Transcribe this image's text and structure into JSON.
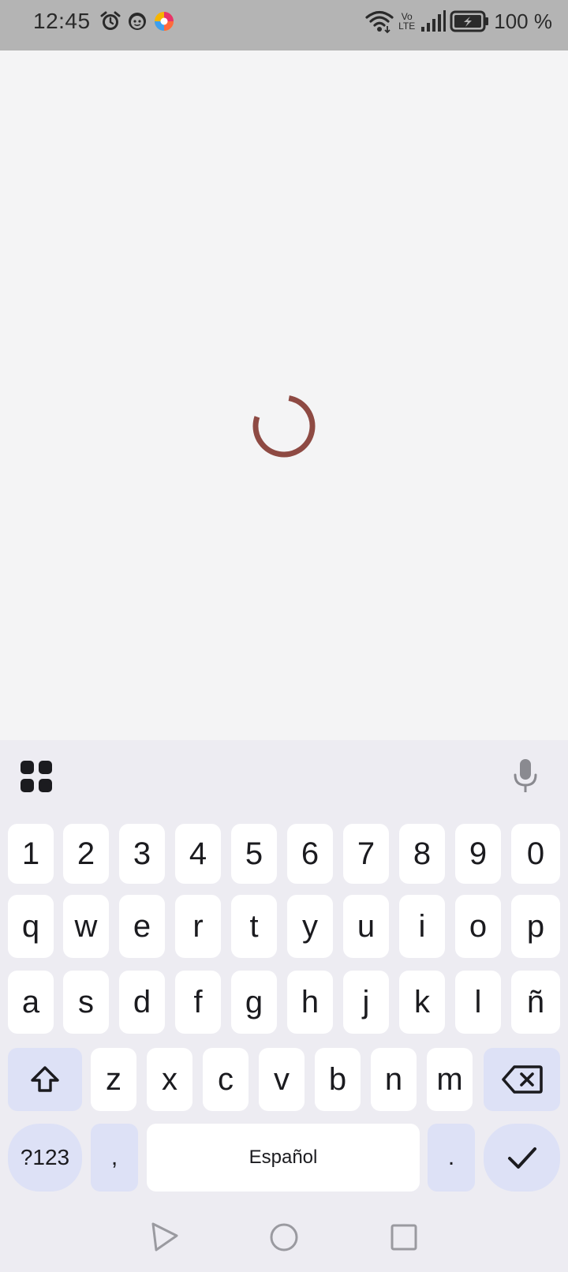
{
  "status_bar": {
    "time": "12:45",
    "left_icons": [
      "alarm-icon",
      "face-icon",
      "app-icon"
    ],
    "right_icons": [
      "wifi-icon",
      "volte-icon",
      "signal-icon",
      "battery-icon"
    ],
    "volte_top": "Vo",
    "volte_bottom": "LTE",
    "battery_percent": "100 %"
  },
  "content": {
    "state": "loading",
    "spinner_color": "#8e4a43"
  },
  "keyboard": {
    "toolbar": {
      "apps_icon": "apps-grid-icon",
      "mic_icon": "mic-icon"
    },
    "row_numbers": [
      "1",
      "2",
      "3",
      "4",
      "5",
      "6",
      "7",
      "8",
      "9",
      "0"
    ],
    "row_1": [
      "q",
      "w",
      "e",
      "r",
      "t",
      "y",
      "u",
      "i",
      "o",
      "p"
    ],
    "row_2": [
      "a",
      "s",
      "d",
      "f",
      "g",
      "h",
      "j",
      "k",
      "l",
      "ñ"
    ],
    "row_3": [
      "z",
      "x",
      "c",
      "v",
      "b",
      "n",
      "m"
    ],
    "shift_icon": "shift-icon",
    "backspace_icon": "backspace-icon",
    "symbols_label": "?123",
    "comma_label": ",",
    "space_label": "Español",
    "period_label": ".",
    "enter_icon": "check-icon",
    "accent_color": "#dde1f6"
  },
  "nav_bar": {
    "back_icon": "back-triangle-icon",
    "home_icon": "home-circle-icon",
    "recents_icon": "recents-square-icon"
  }
}
